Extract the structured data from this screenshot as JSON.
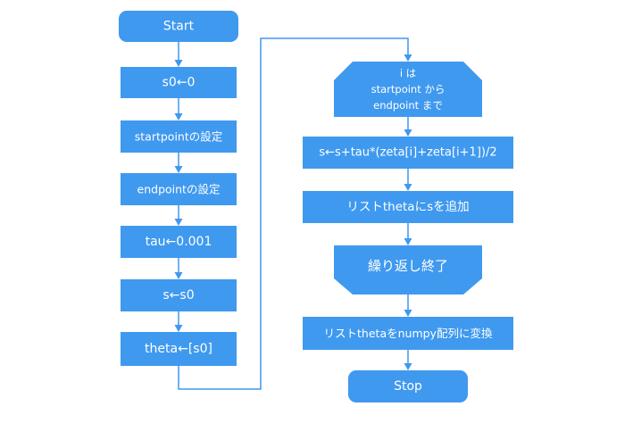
{
  "colors": {
    "node_fill": "#3f99ef",
    "node_text": "#ffffff",
    "edge": "#3f99ef"
  },
  "left_column": {
    "start": "Start",
    "init_s0": "s0←0",
    "set_startpoint": "startpointの設定",
    "set_endpoint": "endpointの設定",
    "set_tau": "tau←0.001",
    "set_s": "s←s0",
    "set_theta": "theta←[s0]"
  },
  "right_column": {
    "loop_start": {
      "line1": "i は",
      "line2": "startpoint から",
      "line3": "endpoint まで"
    },
    "update_s": "s←s+tau*(zeta[i]+zeta[i+1])/2",
    "append_s": "リストthetaにsを追加",
    "loop_end": "繰り返し終了",
    "convert_numpy": "リストthetaをnumpy配列に変換",
    "stop": "Stop"
  }
}
